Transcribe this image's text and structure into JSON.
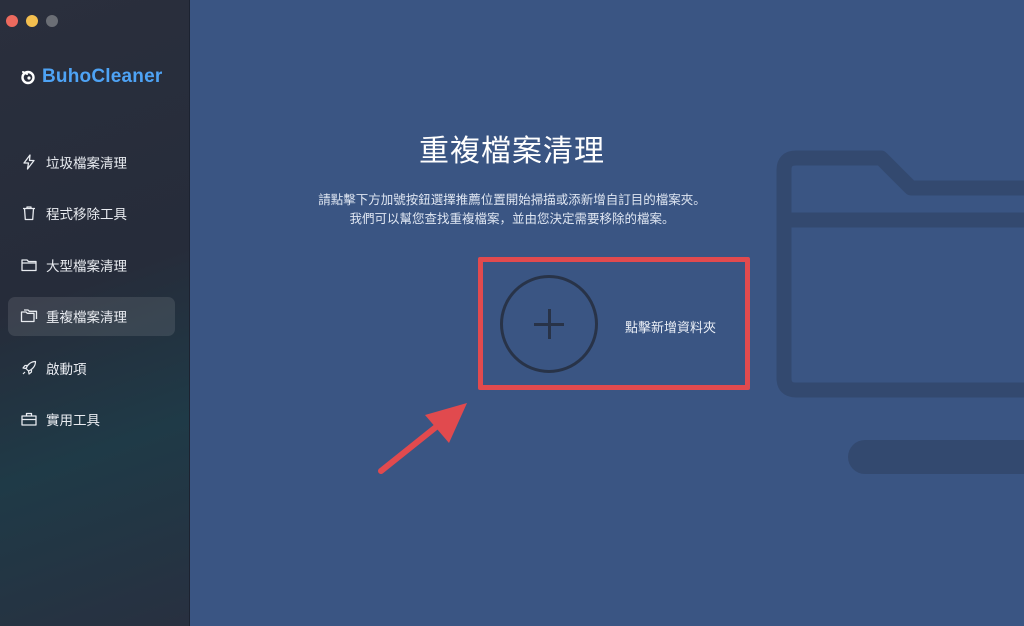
{
  "app": {
    "brand_name": "BuhoCleaner",
    "accent_color": "#4ea3f5"
  },
  "sidebar": {
    "items": [
      {
        "label": "垃圾檔案清理",
        "icon": "lightning-icon",
        "active": false
      },
      {
        "label": "程式移除工具",
        "icon": "trash-icon",
        "active": false
      },
      {
        "label": "大型檔案清理",
        "icon": "folder-icon",
        "active": false
      },
      {
        "label": "重複檔案清理",
        "icon": "duplicate-folder-icon",
        "active": true
      },
      {
        "label": "啟動項",
        "icon": "rocket-icon",
        "active": false
      },
      {
        "label": "實用工具",
        "icon": "toolbox-icon",
        "active": false
      }
    ]
  },
  "main": {
    "title": "重複檔案清理",
    "description_line1": "請點擊下方加號按鈕選擇推薦位置開始掃描或添新增自訂目的檔案夾。",
    "description_line2": "我們可以幫您查找重複檔案，並由您決定需要移除的檔案。",
    "add_folder_label": "點擊新增資料夾",
    "add_icon": "plus-icon",
    "highlight_color": "#e14a4e"
  }
}
